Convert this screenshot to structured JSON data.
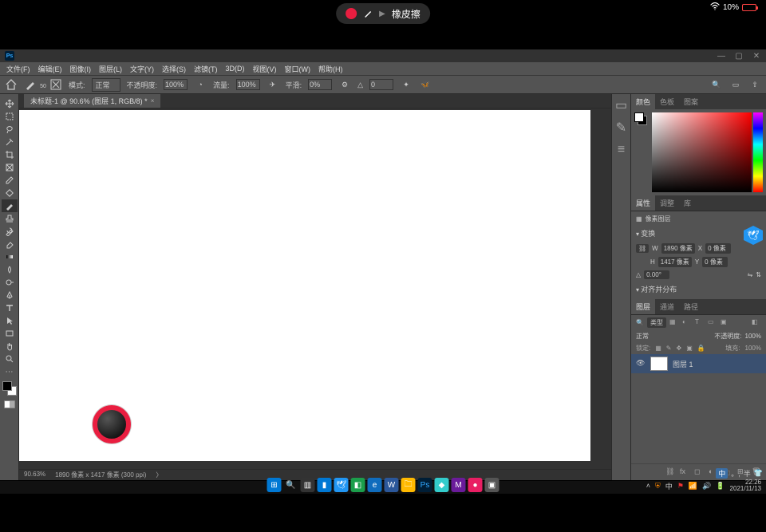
{
  "ipad": {
    "battery": "10%"
  },
  "indicator": {
    "tool": "橡皮擦"
  },
  "titlebar": {
    "logo": "Ps"
  },
  "menu": {
    "file": "文件(F)",
    "edit": "编辑(E)",
    "image": "图像(I)",
    "layer": "图层(L)",
    "type": "文字(Y)",
    "select": "选择(S)",
    "filter": "滤镜(T)",
    "threeD": "3D(D)",
    "view": "视图(V)",
    "window": "窗口(W)",
    "help": "帮助(H)"
  },
  "options": {
    "brush_size": "50",
    "mode_label": "模式:",
    "mode_value": "正常",
    "opacity_label": "不透明度:",
    "opacity_value": "100%",
    "flow_label": "流量:",
    "flow_value": "100%",
    "smooth_label": "平滑:",
    "smooth_value": "0%",
    "angle_value": "0"
  },
  "doc": {
    "tab": "未标题-1 @ 90.6% (图层 1, RGB/8) *",
    "zoom": "90.63%",
    "dims": "1890 像素 x 1417 像素 (300 ppi)"
  },
  "panel_tabs": {
    "color": "颜色",
    "swatches": "色板",
    "patterns": "图案",
    "props": "属性",
    "adjust": "调整",
    "lib": "库",
    "layers": "图层",
    "channels": "通道",
    "paths": "路径"
  },
  "props": {
    "pixel_layer": "像素图层",
    "transform_head": "变换",
    "w_label": "W",
    "w_val": "1890 像素",
    "x_label": "X",
    "x_val": "0 像素",
    "h_label": "H",
    "h_val": "1417 像素",
    "y_label": "Y",
    "y_val": "0 像素",
    "angle_val": "0.00°",
    "align_head": "对齐并分布"
  },
  "layers": {
    "kind": "类型",
    "blend": "正常",
    "blend_op_label": "不透明度:",
    "blend_op_val": "100%",
    "lock_label": "锁定:",
    "fill_label": "填充:",
    "fill_val": "100%",
    "layer1": "图层 1"
  },
  "ime": {
    "zhong": "中",
    "dot": "。,",
    "ban": "半",
    "shirt": "👕"
  },
  "tray": {
    "zhong": "中",
    "time": "22:26",
    "date": "2021/11/13"
  }
}
